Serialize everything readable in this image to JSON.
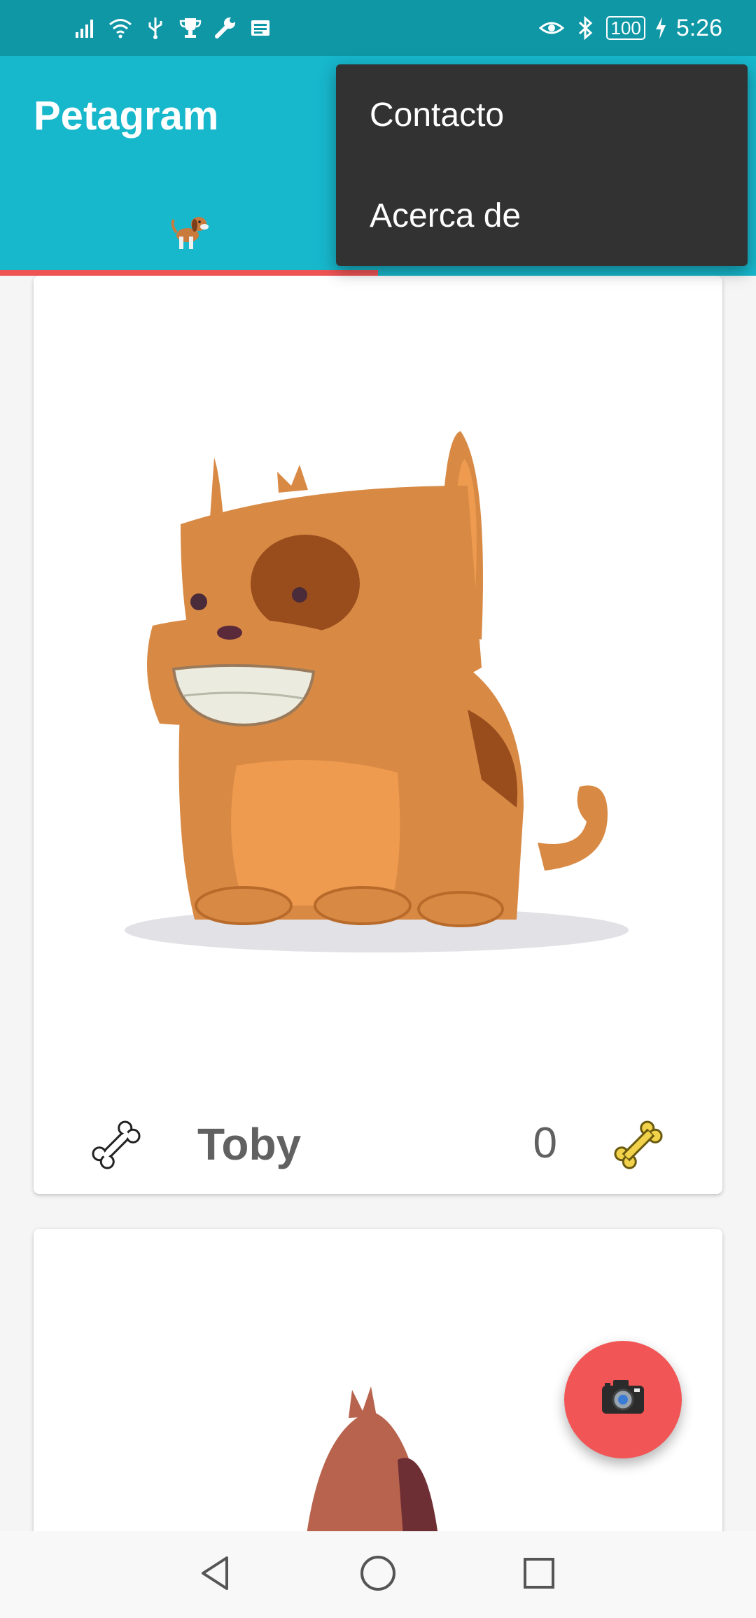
{
  "status_bar": {
    "time": "5:26",
    "battery": "100",
    "icons": [
      "signal-icon",
      "wifi-icon",
      "usb-icon",
      "trophy-icon",
      "wrench-icon",
      "news-icon",
      "eye-icon",
      "bluetooth-icon",
      "charging-icon"
    ]
  },
  "app_bar": {
    "title": "Petagram",
    "tabs": [
      {
        "icon": "dog-icon",
        "selected": true
      }
    ],
    "accent": "#17b7cc",
    "indicator_color": "#ef5454"
  },
  "menu": {
    "items": [
      "Contacto",
      "Acerca de"
    ]
  },
  "pets": [
    {
      "name": "Toby",
      "likes": "0"
    }
  ],
  "fab": {
    "icon": "camera-icon",
    "color": "#f15555"
  },
  "nav": {
    "icons": [
      "back-icon",
      "home-icon",
      "recents-icon"
    ]
  }
}
